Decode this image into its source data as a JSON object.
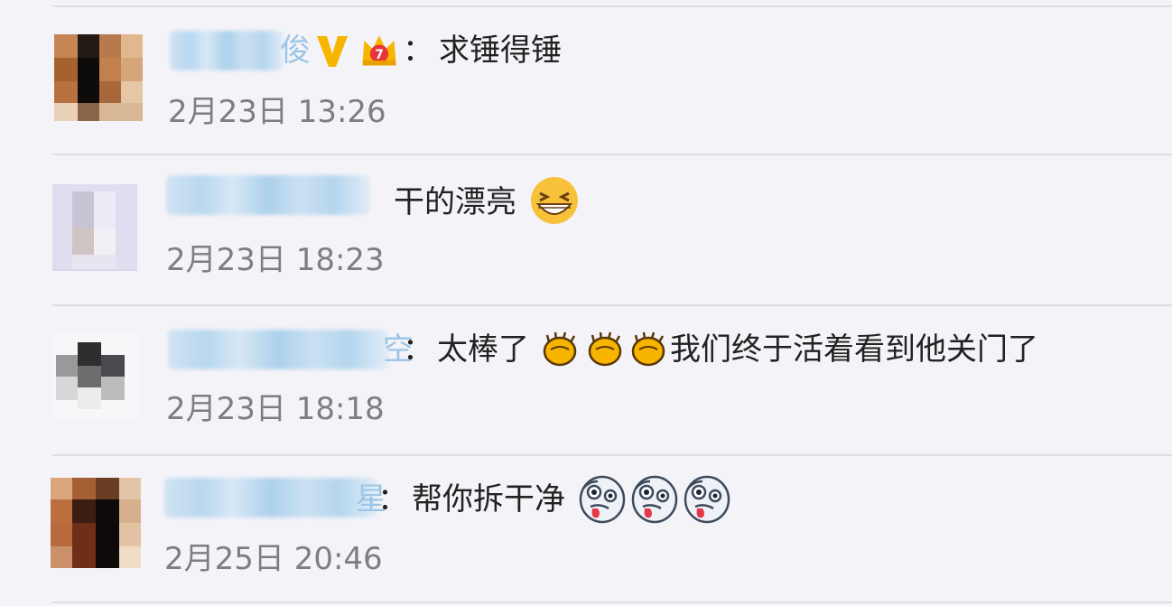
{
  "comments": [
    {
      "name_tail": "俊",
      "colon": "：",
      "text": "求锤得锤",
      "time": "2月23日 13:26",
      "badges": [
        "verified-v-icon",
        "vip-crown-icon"
      ]
    },
    {
      "text": "干的漂亮",
      "time": "2月23日 18:23",
      "emojis": [
        "grin-emoji"
      ]
    },
    {
      "name_tail": "空",
      "colon": "：",
      "text_before": "太棒了",
      "text_after": "我们终于活着看到他关门了",
      "time": "2月23日 18:18",
      "emojis": [
        "clap-emoji",
        "clap-emoji",
        "clap-emoji"
      ]
    },
    {
      "name_tail": "星",
      "colon": "：",
      "text": "帮你拆干净",
      "time": "2月25日 20:46",
      "emojis": [
        "crazy-face-emoji",
        "crazy-face-emoji",
        "crazy-face-emoji"
      ]
    }
  ]
}
